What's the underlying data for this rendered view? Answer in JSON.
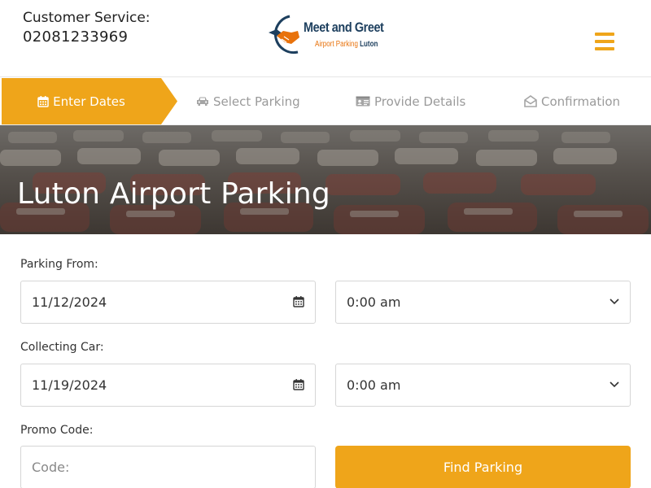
{
  "header": {
    "customer_service_label": "Customer Service:",
    "customer_service_phone": "02081233969",
    "logo_title": "Meet and Greet",
    "logo_sub_prefix": "Airport Parking ",
    "logo_sub_suffix": "Luton",
    "menu_icon": "hamburger-icon"
  },
  "steps": [
    {
      "label": "Enter Dates",
      "icon": "calendar-icon",
      "active": true
    },
    {
      "label": "Select Parking",
      "icon": "car-icon",
      "active": false
    },
    {
      "label": "Provide Details",
      "icon": "id-card-icon",
      "active": false
    },
    {
      "label": "Confirmation",
      "icon": "envelope-open-icon",
      "active": false
    }
  ],
  "hero": {
    "title": "Luton Airport Parking"
  },
  "form": {
    "parking_from_label": "Parking From:",
    "parking_from_date": "11/12/2024",
    "parking_from_time": "0:00 am",
    "collecting_label": "Collecting Car:",
    "collecting_date": "11/19/2024",
    "collecting_time": "0:00 am",
    "promo_label": "Promo Code:",
    "promo_placeholder": "Code:",
    "submit_label": "Find Parking"
  },
  "colors": {
    "accent": "#efa51a",
    "brand_dark": "#1d3f5e",
    "brand_orange": "#e8720c"
  }
}
